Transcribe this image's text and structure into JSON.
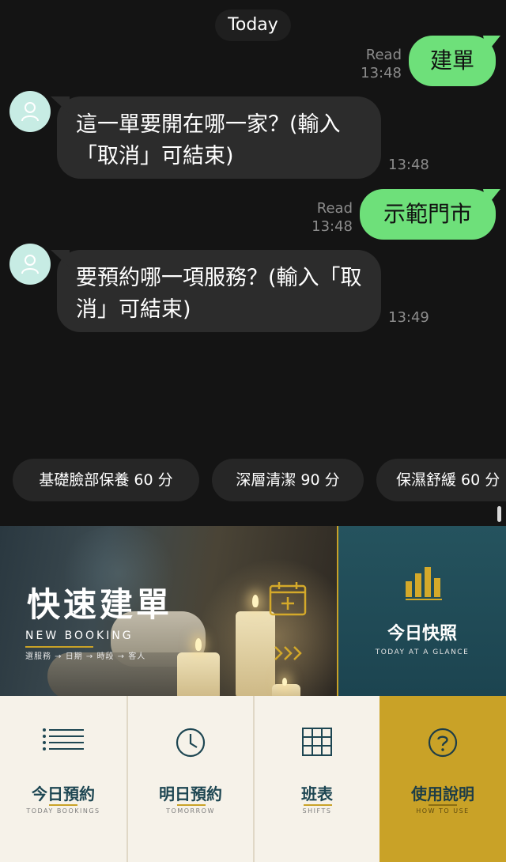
{
  "date_label": "Today",
  "messages": [
    {
      "dir": "out",
      "text": "建單",
      "status": "Read",
      "time": "13:48"
    },
    {
      "dir": "in",
      "text": "這一單要開在哪一家？(輸入「取消」可結束)",
      "time": "13:48"
    },
    {
      "dir": "out",
      "text": "示範門市",
      "status": "Read",
      "time": "13:48"
    },
    {
      "dir": "in",
      "text": "要預約哪一項服務？(輸入「取消」可結束)",
      "time": "13:49"
    }
  ],
  "quick_replies": [
    "基礎臉部保養 60 分",
    "深層清潔 90 分",
    "保濕舒緩 60 分"
  ],
  "rich_menu": {
    "booking": {
      "title": "快速建單",
      "subtitle": "NEW BOOKING",
      "steps": "選服務 → 日期 → 時段 → 客人"
    },
    "glance": {
      "title": "今日快照",
      "subtitle": "TODAY AT A GLANCE"
    },
    "today": {
      "title": "今日預約",
      "subtitle": "TODAY BOOKINGS"
    },
    "tomorrow": {
      "title": "明日預約",
      "subtitle": "TOMORROW"
    },
    "shifts": {
      "title": "班表",
      "subtitle": "SHIFTS"
    },
    "help": {
      "title": "使用說明",
      "subtitle": "HOW TO USE"
    }
  },
  "colors": {
    "accent_gold": "#c9a227",
    "teal": "#1d4652",
    "outgoing_bubble": "#6ee07a",
    "incoming_bubble": "#2c2c2c"
  }
}
